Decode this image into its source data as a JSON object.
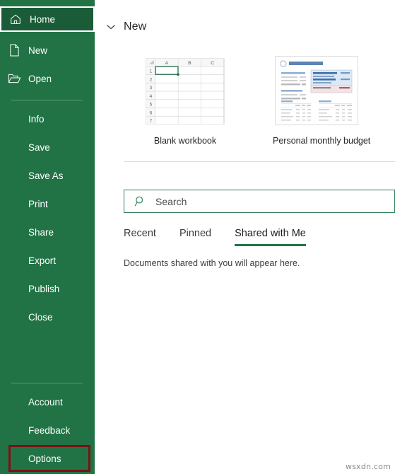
{
  "theme": {
    "sidebar_bg": "#217346",
    "sidebar_selected_bg": "#1a5c38",
    "accent_green": "#217346",
    "annotation_red": "#7b1113",
    "text_dark": "#262626"
  },
  "sidebar": {
    "top_items": [
      {
        "label": "Home",
        "icon": "home-icon",
        "selected": true
      },
      {
        "label": "New",
        "icon": "new-document-icon",
        "selected": false
      },
      {
        "label": "Open",
        "icon": "open-folder-icon",
        "selected": false
      }
    ],
    "main_items": [
      {
        "label": "Info"
      },
      {
        "label": "Save"
      },
      {
        "label": "Save As"
      },
      {
        "label": "Print"
      },
      {
        "label": "Share"
      },
      {
        "label": "Export"
      },
      {
        "label": "Publish"
      },
      {
        "label": "Close"
      }
    ],
    "bottom_items": [
      {
        "label": "Account"
      },
      {
        "label": "Feedback"
      },
      {
        "label": "Options",
        "highlighted": true
      }
    ]
  },
  "main": {
    "section_header": {
      "title": "New",
      "collapse_icon": "chevron-down-icon"
    },
    "templates": [
      {
        "caption": "Blank workbook",
        "thumb_type": "spreadsheet-grid",
        "columns": [
          "A",
          "B",
          "C"
        ],
        "rows": [
          "1",
          "2",
          "3",
          "4",
          "5",
          "6",
          "7"
        ],
        "selected_cell": "A1"
      },
      {
        "caption": "Personal monthly budget",
        "thumb_type": "budget-template-preview",
        "preview_title": "Personal Monthly Budget"
      }
    ],
    "search": {
      "placeholder": "Search",
      "value": "",
      "icon": "search-icon"
    },
    "tabs": [
      {
        "label": "Recent",
        "active": false
      },
      {
        "label": "Pinned",
        "active": false
      },
      {
        "label": "Shared with Me",
        "active": true
      }
    ],
    "empty_message": "Documents shared with you will appear here."
  },
  "watermark": {
    "text": "wsxdn.com"
  }
}
